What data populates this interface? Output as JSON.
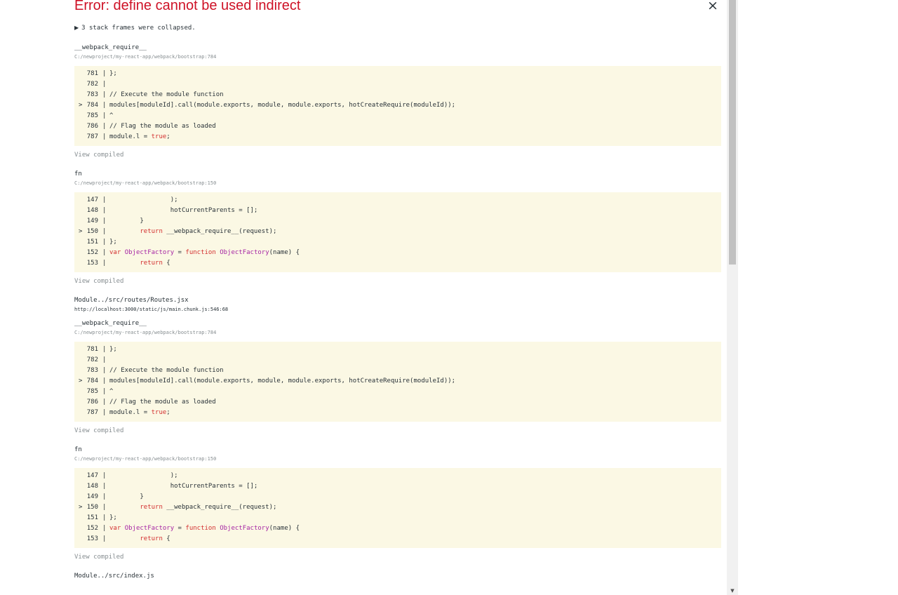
{
  "error": {
    "title": "Error: define cannot be used indirect",
    "close_symbol": "×",
    "collapsed_toggle": "3 stack frames were collapsed.",
    "collapsed_icon": "triangle-right-icon"
  },
  "view_compiled_label": "View compiled",
  "frames": [
    {
      "fn": "__webpack_require__",
      "location": "C:/newproject/my-react-app/webpack/bootstrap:784",
      "lines": [
        {
          "num": "781",
          "tokens": [
            {
              "t": "};"
            }
          ]
        },
        {
          "num": "782",
          "tokens": []
        },
        {
          "num": "783",
          "tokens": [
            {
              "t": "// Execute the module function"
            }
          ]
        },
        {
          "num": "784",
          "hl": true,
          "tokens": [
            {
              "t": "modules[moduleId].call(module.exports, module, module.exports, hotCreateRequire(moduleId));"
            }
          ]
        },
        {
          "num": "785",
          "tokens": [
            {
              "t": "^"
            }
          ]
        },
        {
          "num": "786",
          "tokens": [
            {
              "t": "// Flag the module as loaded"
            }
          ]
        },
        {
          "num": "787",
          "tokens": [
            {
              "t": "module.l = "
            },
            {
              "t": "true",
              "c": "red"
            },
            {
              "t": ";"
            }
          ]
        }
      ]
    },
    {
      "fn": "fn",
      "location": "C:/newproject/my-react-app/webpack/bootstrap:150",
      "lines": [
        {
          "num": "147",
          "tokens": [
            {
              "t": "                );"
            }
          ]
        },
        {
          "num": "148",
          "tokens": [
            {
              "t": "                hotCurrentParents = [];"
            }
          ]
        },
        {
          "num": "149",
          "tokens": [
            {
              "t": "        }"
            }
          ]
        },
        {
          "num": "150",
          "hl": true,
          "tokens": [
            {
              "t": "        "
            },
            {
              "t": "return",
              "c": "red"
            },
            {
              "t": " __webpack_require__(request);"
            }
          ]
        },
        {
          "num": "151",
          "tokens": [
            {
              "t": "};"
            }
          ]
        },
        {
          "num": "152",
          "tokens": [
            {
              "t": "var ",
              "c": "red"
            },
            {
              "t": "ObjectFactory",
              "c": "kw"
            },
            {
              "t": " = "
            },
            {
              "t": "function",
              "c": "red"
            },
            {
              "t": " "
            },
            {
              "t": "ObjectFactory",
              "c": "kw"
            },
            {
              "t": "(name) {"
            }
          ]
        },
        {
          "num": "153",
          "tokens": [
            {
              "t": "        "
            },
            {
              "t": "return",
              "c": "red"
            },
            {
              "t": " {"
            }
          ]
        }
      ]
    },
    {
      "fn": "Module../src/routes/Routes.jsx",
      "location": "http://localhost:3000/static/js/main.chunk.js:546:68",
      "location_dark": true,
      "lines": []
    },
    {
      "fn": "__webpack_require__",
      "location": "C:/newproject/my-react-app/webpack/bootstrap:784",
      "lines": [
        {
          "num": "781",
          "tokens": [
            {
              "t": "};"
            }
          ]
        },
        {
          "num": "782",
          "tokens": []
        },
        {
          "num": "783",
          "tokens": [
            {
              "t": "// Execute the module function"
            }
          ]
        },
        {
          "num": "784",
          "hl": true,
          "tokens": [
            {
              "t": "modules[moduleId].call(module.exports, module, module.exports, hotCreateRequire(moduleId));"
            }
          ]
        },
        {
          "num": "785",
          "tokens": [
            {
              "t": "^"
            }
          ]
        },
        {
          "num": "786",
          "tokens": [
            {
              "t": "// Flag the module as loaded"
            }
          ]
        },
        {
          "num": "787",
          "tokens": [
            {
              "t": "module.l = "
            },
            {
              "t": "true",
              "c": "red"
            },
            {
              "t": ";"
            }
          ]
        }
      ]
    },
    {
      "fn": "fn",
      "location": "C:/newproject/my-react-app/webpack/bootstrap:150",
      "lines": [
        {
          "num": "147",
          "tokens": [
            {
              "t": "                );"
            }
          ]
        },
        {
          "num": "148",
          "tokens": [
            {
              "t": "                hotCurrentParents = [];"
            }
          ]
        },
        {
          "num": "149",
          "tokens": [
            {
              "t": "        }"
            }
          ]
        },
        {
          "num": "150",
          "hl": true,
          "tokens": [
            {
              "t": "        "
            },
            {
              "t": "return",
              "c": "red"
            },
            {
              "t": " __webpack_require__(request);"
            }
          ]
        },
        {
          "num": "151",
          "tokens": [
            {
              "t": "};"
            }
          ]
        },
        {
          "num": "152",
          "tokens": [
            {
              "t": "var ",
              "c": "red"
            },
            {
              "t": "ObjectFactory",
              "c": "kw"
            },
            {
              "t": " = "
            },
            {
              "t": "function",
              "c": "red"
            },
            {
              "t": " "
            },
            {
              "t": "ObjectFactory",
              "c": "kw"
            },
            {
              "t": "(name) {"
            }
          ]
        },
        {
          "num": "153",
          "tokens": [
            {
              "t": "        "
            },
            {
              "t": "return",
              "c": "red"
            },
            {
              "t": " {"
            }
          ]
        }
      ]
    },
    {
      "fn": "Module../src/index.js",
      "location": "",
      "lines": []
    }
  ],
  "scrollbar": {
    "down_icon": "scroll-down-arrow-icon",
    "thumb_fraction": 0.44
  }
}
